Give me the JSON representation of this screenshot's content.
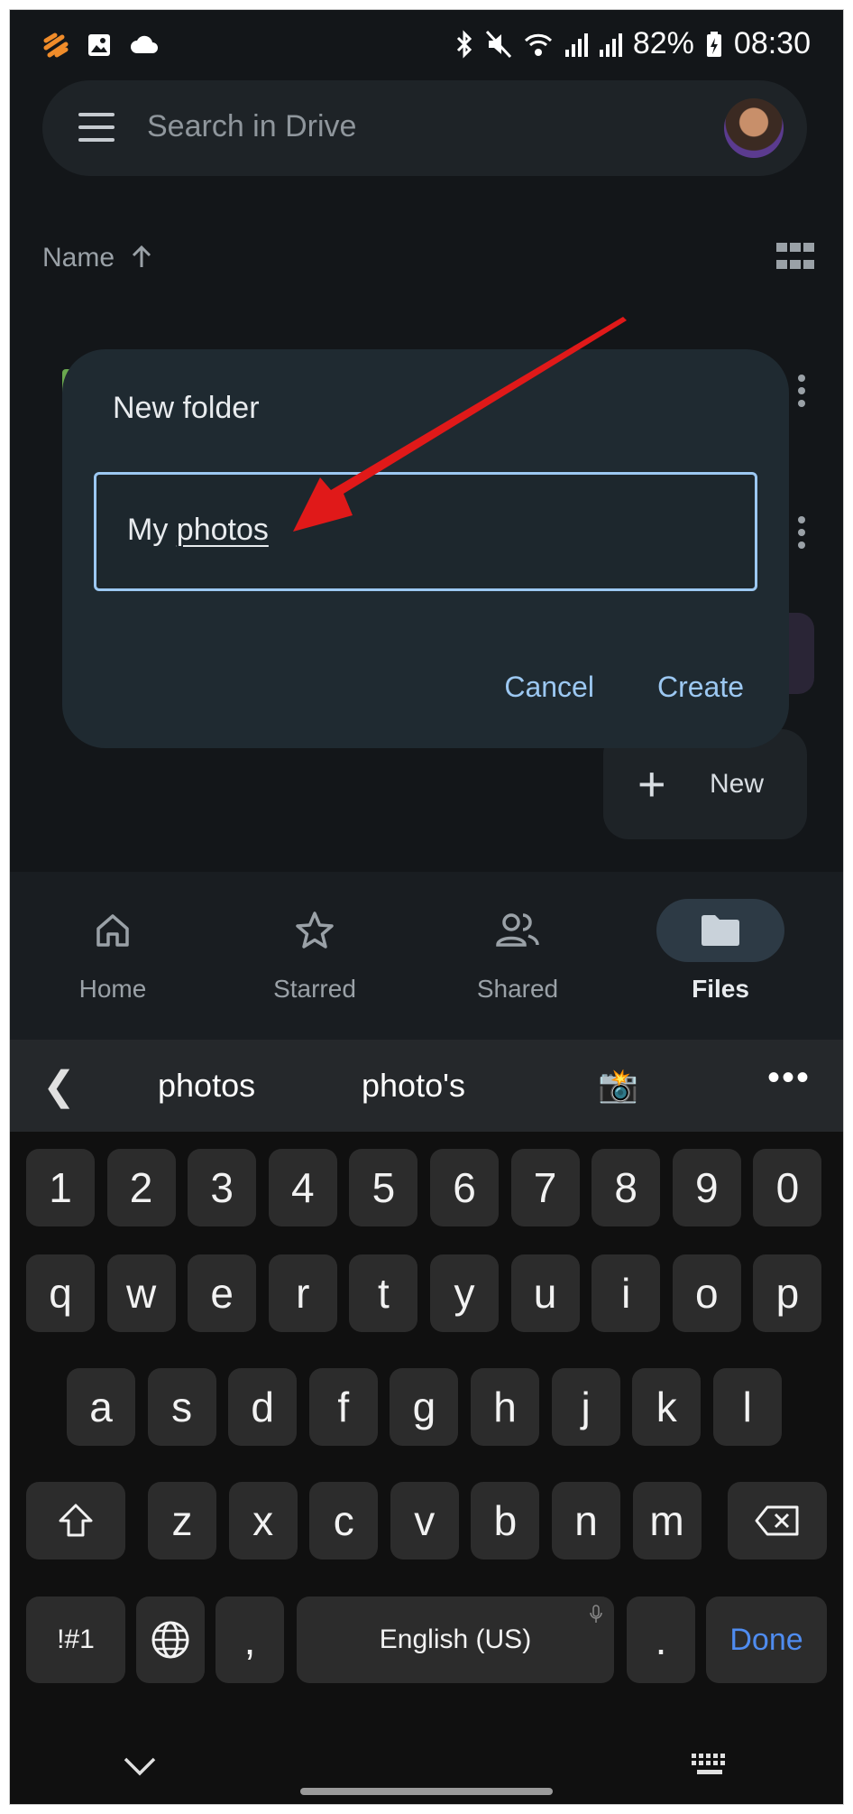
{
  "status_bar": {
    "battery": "82%",
    "time": "08:30"
  },
  "search": {
    "placeholder": "Search in Drive"
  },
  "sort": {
    "label": "Name",
    "direction_icon": "arrow-up-icon"
  },
  "dialog": {
    "title": "New folder",
    "input_value_plain": "My ",
    "input_value_underlined": "photos",
    "cancel_label": "Cancel",
    "create_label": "Create"
  },
  "fab": {
    "label": "New"
  },
  "bottom_nav": [
    {
      "label": "Home",
      "icon": "home-icon"
    },
    {
      "label": "Starred",
      "icon": "star-icon"
    },
    {
      "label": "Shared",
      "icon": "people-icon"
    },
    {
      "label": "Files",
      "icon": "folder-icon",
      "active": true
    }
  ],
  "keyboard": {
    "suggestions": [
      "photos",
      "photo's",
      "📸"
    ],
    "rows": {
      "numbers": [
        "1",
        "2",
        "3",
        "4",
        "5",
        "6",
        "7",
        "8",
        "9",
        "0"
      ],
      "row1": [
        "q",
        "w",
        "e",
        "r",
        "t",
        "y",
        "u",
        "i",
        "o",
        "p"
      ],
      "row2": [
        "a",
        "s",
        "d",
        "f",
        "g",
        "h",
        "j",
        "k",
        "l"
      ],
      "row3": [
        "z",
        "x",
        "c",
        "v",
        "b",
        "n",
        "m"
      ]
    },
    "symbols_label": "!#1",
    "comma_label": ",",
    "space_label": "English (US)",
    "period_label": ".",
    "done_label": "Done"
  },
  "colors": {
    "accent": "#9cc8f2",
    "done": "#4f8cf0",
    "annotation_arrow": "#e01919"
  }
}
